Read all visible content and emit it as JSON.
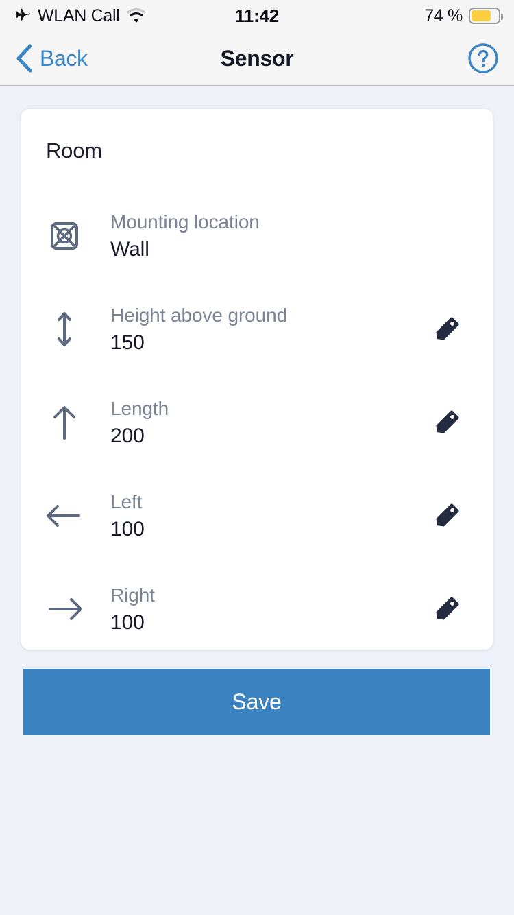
{
  "status_bar": {
    "carrier": "WLAN Call",
    "airplane_icon": "airplane-icon",
    "wifi_icon": "wifi-icon",
    "time": "11:42",
    "battery_text": "74 %",
    "battery_percent": 74,
    "battery_color": "#fbcf41"
  },
  "nav_bar": {
    "back_label": "Back",
    "back_icon": "chevron-left-icon",
    "title": "Sensor",
    "help_icon": "question-circle-icon",
    "accent_color": "#3d87c6"
  },
  "card": {
    "title": "Room",
    "rows": [
      {
        "icon": "wall-mount-icon",
        "label": "Mounting location",
        "value": "Wall",
        "has_edit": false
      },
      {
        "icon": "arrow-up-down-icon",
        "label": "Height above ground",
        "value": "150",
        "has_edit": true
      },
      {
        "icon": "arrow-up-icon",
        "label": "Length",
        "value": "200",
        "has_edit": true
      },
      {
        "icon": "arrow-left-icon",
        "label": "Left",
        "value": "100",
        "has_edit": true
      },
      {
        "icon": "arrow-right-icon",
        "label": "Right",
        "value": "100",
        "has_edit": true
      }
    ],
    "edit_icon": "pencil-icon"
  },
  "footer": {
    "save_label": "Save",
    "save_color": "#3b83c0"
  },
  "theme": {
    "page_background": "#eef1f7",
    "card_background": "#ffffff",
    "label_color": "#7b8494",
    "value_color": "#16192a",
    "icon_color": "#5d697f",
    "pencil_color": "#242b40"
  }
}
